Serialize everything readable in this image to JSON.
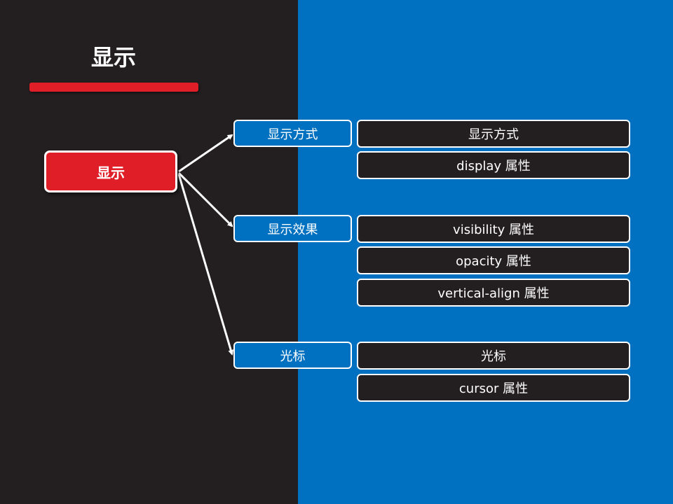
{
  "slide": {
    "title": "显示",
    "colors": {
      "left_bg": "#231f20",
      "right_bg": "#0070c0",
      "accent": "#e01e27",
      "line": "#ffffff"
    }
  },
  "mindmap": {
    "root": {
      "label": "显示"
    },
    "branches": [
      {
        "label": "显示方式",
        "items": [
          "显示方式",
          "display 属性"
        ]
      },
      {
        "label": "显示效果",
        "items": [
          "visibility 属性",
          "opacity 属性",
          "vertical-align 属性"
        ]
      },
      {
        "label": "光标",
        "items": [
          "光标",
          "cursor 属性"
        ]
      }
    ]
  }
}
